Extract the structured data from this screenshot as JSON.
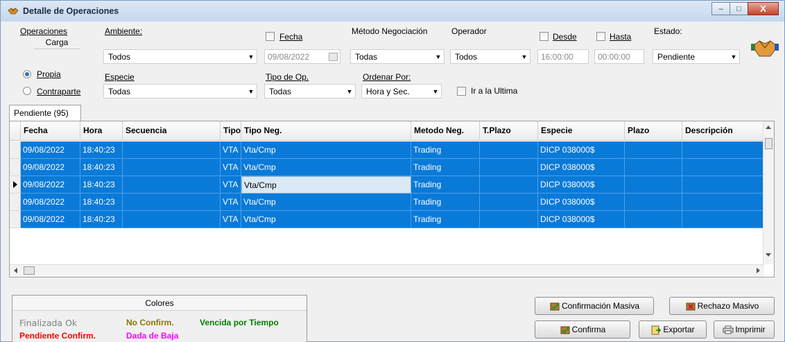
{
  "window": {
    "title": "Detalle de Operaciones",
    "controls": {
      "minimize": "–",
      "maximize": "□",
      "close": "X"
    }
  },
  "filters": {
    "operaciones_label": "Operaciones",
    "carga_label": "Carga",
    "propia_label": "Propia",
    "contraparte_label": "Contraparte",
    "carga_selected": "Propia",
    "ambiente_label": "Ambiente:",
    "ambiente_value": "Todos",
    "especie_label": "Especie",
    "especie_value": "Todas",
    "fecha_label": "Fecha",
    "fecha_value": "09/08/2022",
    "fecha_checked": false,
    "tipo_op_label": "Tipo de Op.",
    "tipo_op_value": "Todas",
    "metodo_label": "Método Negociación",
    "metodo_value": "Todas",
    "ordenar_label": "Ordenar Por:",
    "ordenar_value": "Hora y Sec.",
    "operador_label": "Operador",
    "operador_value": "Todos",
    "ir_ultima_label": "Ir a la Ultima",
    "ir_ultima_checked": false,
    "desde_label": "Desde",
    "desde_value": "16:00:00",
    "desde_checked": false,
    "hasta_label": "Hasta",
    "hasta_value": "00:00:00",
    "hasta_checked": false,
    "estado_label": "Estado:",
    "estado_value": "Pendiente"
  },
  "tab": {
    "label": "Pendiente (95)"
  },
  "grid": {
    "columns": [
      "Fecha",
      "Hora",
      "Secuencia",
      "Tipo",
      "Tipo Neg.",
      "Metodo Neg.",
      "T.Plazo",
      "Especie",
      "Plazo",
      "Descripción"
    ],
    "rows": [
      [
        "09/08/2022",
        "18:40:23",
        "",
        "VTA",
        "Vta/Cmp",
        "Trading",
        "",
        "DICP  038000$",
        "",
        ""
      ],
      [
        "09/08/2022",
        "18:40:23",
        "",
        "VTA",
        "Vta/Cmp",
        "Trading",
        "",
        "DICP  038000$",
        "",
        ""
      ],
      [
        "09/08/2022",
        "18:40:23",
        "",
        "VTA",
        "Vta/Cmp",
        "Trading",
        "",
        "DICP  038000$",
        "",
        ""
      ],
      [
        "09/08/2022",
        "18:40:23",
        "",
        "VTA",
        "Vta/Cmp",
        "Trading",
        "",
        "DICP  038000$",
        "",
        ""
      ],
      [
        "09/08/2022",
        "18:40:23",
        "",
        "VTA",
        "Vta/Cmp",
        "Trading",
        "",
        "DICP  038000$",
        "",
        ""
      ]
    ],
    "selected_color": "#0a7ad8",
    "current_row": 3
  },
  "legend": {
    "title": "Colores",
    "items": [
      {
        "text": "Finalizada Ok",
        "color": "#808080"
      },
      {
        "text": "No Confirm.",
        "color": "#8b7500"
      },
      {
        "text": "Vencida por Tiempo",
        "color": "#008000"
      },
      {
        "text": "Pendiente Confirm.",
        "color": "#ff0000"
      },
      {
        "text": "Dada de Baja",
        "color": "#ff00ff"
      }
    ]
  },
  "buttons": {
    "confirmacion_masiva": "Confirmación Masiva",
    "rechazo_masivo": "Rechazo Masivo",
    "confirma": "Confirma",
    "exportar": "Exportar",
    "imprimir": "Imprimir"
  }
}
